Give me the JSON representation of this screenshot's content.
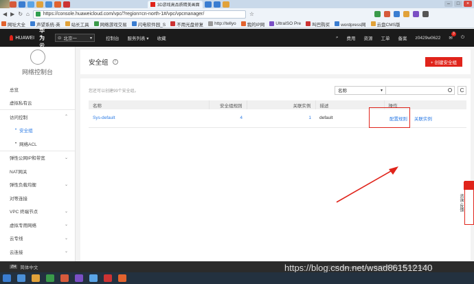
{
  "browser": {
    "active_tab_title": "3D游戏高品质精美画面",
    "url": "https://console.huaweicloud.com/vpc/?region=cn-north-1#/vpc/vpcmanager/",
    "bookmarks": [
      "网址大全",
      "声望系统-英",
      "站长工具",
      "网络游戏交易",
      "闪电软件园_S",
      "不用光盘修复",
      "http://tellyo",
      "我的IP网",
      "UltraISO Pre",
      "叫巴购买",
      "wordpress网",
      "云盘CMS版"
    ]
  },
  "topnav": {
    "brand": "HUAWEI",
    "cloud": "华为云",
    "region": "北京一",
    "menu": [
      "控制台",
      "服务列表",
      "收藏"
    ],
    "right": [
      "费用",
      "资源",
      "工单",
      "备案",
      "z0429w0622"
    ],
    "badge_count": "3"
  },
  "sidebar": {
    "title": "网络控制台",
    "items": [
      {
        "label": "总览"
      },
      {
        "label": "虚拟私有云"
      },
      {
        "label": "访问控制"
      },
      {
        "label": "安全组"
      },
      {
        "label": "网络ACL"
      },
      {
        "label": "弹性公网IP和带宽"
      },
      {
        "label": "NAT网关"
      },
      {
        "label": "弹性负载均衡"
      },
      {
        "label": "对等连接"
      },
      {
        "label": "VPC 终端节点"
      },
      {
        "label": "虚拟专用网络"
      },
      {
        "label": "云专线"
      },
      {
        "label": "云连接"
      }
    ]
  },
  "page": {
    "title": "安全组",
    "help": "?",
    "create_button": "+ 创建安全组",
    "hint": "您还可以创建99个安全组。",
    "filter_select": "名称",
    "refresh": "C"
  },
  "table": {
    "headers": [
      "名称",
      "安全组规则",
      "关联实例",
      "描述",
      "操作"
    ],
    "rows": [
      {
        "name": "Sys-default",
        "rules": "4",
        "instances": "1",
        "desc": "default",
        "op1": "配置规则",
        "op2": "关联实例"
      }
    ]
  },
  "feedback": "咨询·反馈",
  "footer": {
    "lang_icon": "ZH",
    "language": "简体中文",
    "copyright": "©2019 Huaweicloud.com 版权所有 黔ICP备20000297号-1"
  },
  "watermark": "https://blog.csdn.net/wsad861512140",
  "colors": {
    "accent": "#e0241b",
    "link": "#2c7be5",
    "nav_bg": "#1b1b1b"
  }
}
